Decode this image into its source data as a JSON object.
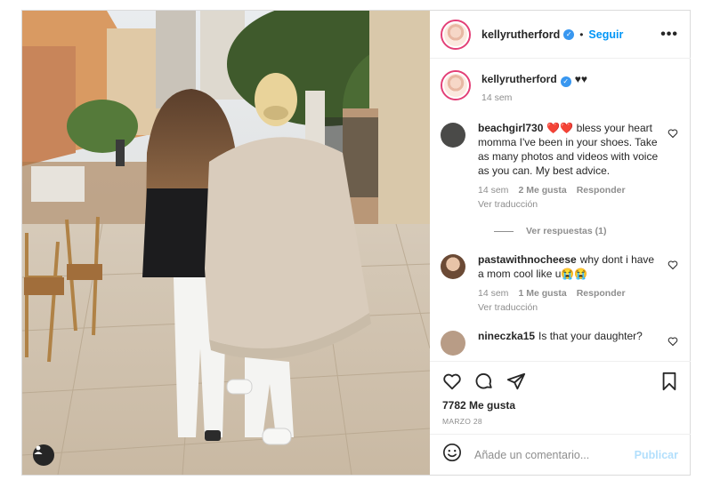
{
  "post": {
    "author": "kellyrutherford",
    "follow_label": "Seguir",
    "more_label": "•••",
    "caption": {
      "username": "kellyrutherford",
      "text": "♥♥",
      "time": "14 sem"
    },
    "comments": [
      {
        "username": "beachgirl730",
        "text": "❤️❤️ bless your heart momma I've been in your shoes. Take as many photos and videos with voice as you can. My best advice.",
        "time": "14 sem",
        "likes": "2 Me gusta",
        "reply": "Responder",
        "translate": "Ver traducción",
        "view_replies": "Ver respuestas (1)"
      },
      {
        "username": "pastawithnocheese",
        "text": "why dont i have a mom cool like u😭😭",
        "time": "14 sem",
        "likes": "1 Me gusta",
        "reply": "Responder",
        "translate": "Ver traducción"
      },
      {
        "username": "nineczka15",
        "text": "Is that your daughter?"
      }
    ],
    "likes_count": "7782 Me gusta",
    "date": "MARZO 28",
    "comment_placeholder": "Añade un comentario...",
    "publish_label": "Publicar"
  },
  "colors": {
    "link_blue": "#0095f6",
    "verified_blue": "#3897f0",
    "publish_disabled": "#b2dffc",
    "story_ring": "#e34077",
    "muted_text": "#8e8e8e"
  },
  "icons": [
    "verified-icon",
    "more-icon",
    "heart-icon",
    "comment-icon",
    "share-icon",
    "bookmark-icon",
    "emoji-icon",
    "tag-user-icon"
  ]
}
